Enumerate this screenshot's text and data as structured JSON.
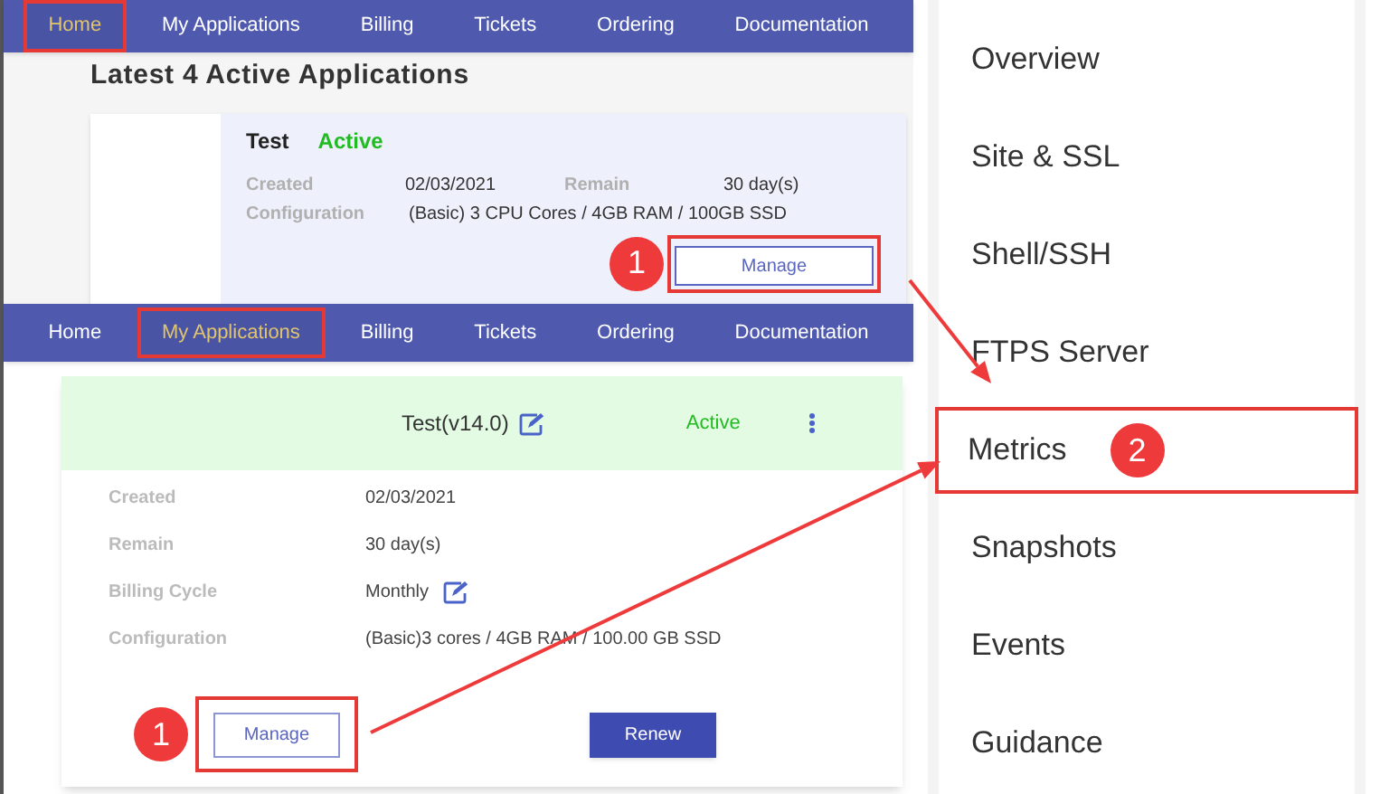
{
  "top_panel": {
    "nav": [
      {
        "label": "Home",
        "selected": true,
        "highlighted": true
      },
      {
        "label": "My Applications",
        "selected": false,
        "highlighted": false
      },
      {
        "label": "Billing",
        "selected": false,
        "highlighted": false
      },
      {
        "label": "Tickets",
        "selected": false,
        "highlighted": false
      },
      {
        "label": "Ordering",
        "selected": false,
        "highlighted": false
      },
      {
        "label": "Documentation",
        "selected": false,
        "highlighted": false
      }
    ],
    "heading": "Latest 4 Active Applications",
    "card": {
      "name": "Test",
      "status": "Active",
      "rows": [
        {
          "cells": [
            {
              "label": "Created",
              "value": "02/03/2021"
            },
            {
              "label": "Remain",
              "value": "30 day(s)"
            }
          ]
        },
        {
          "cells": [
            {
              "label": "Configuration",
              "value": "(Basic) 3 CPU Cores / 4GB RAM / 100GB SSD"
            }
          ]
        }
      ],
      "button": {
        "label": "Manage",
        "highlighted": true
      },
      "callout": "1"
    }
  },
  "bottom_panel": {
    "nav": [
      {
        "label": "Home",
        "selected": false,
        "highlighted": false
      },
      {
        "label": "My Applications",
        "selected": true,
        "highlighted": true
      },
      {
        "label": "Billing",
        "selected": false,
        "highlighted": false
      },
      {
        "label": "Tickets",
        "selected": false,
        "highlighted": false
      },
      {
        "label": "Ordering",
        "selected": false,
        "highlighted": false
      },
      {
        "label": "Documentation",
        "selected": false,
        "highlighted": false
      }
    ],
    "card": {
      "title": "Test(v14.0)",
      "status": "Active",
      "fields": [
        {
          "label": "Created",
          "value": "02/03/2021",
          "editable": false
        },
        {
          "label": "Remain",
          "value": "30 day(s)",
          "editable": false
        },
        {
          "label": "Billing Cycle",
          "value": "Monthly",
          "editable": true
        },
        {
          "label": "Configuration",
          "value": "(Basic)3 cores / 4GB RAM / 100.00 GB SSD",
          "editable": false
        }
      ],
      "callout": "1",
      "buttons": [
        {
          "label": "Manage",
          "kind": "outline",
          "highlighted": true
        },
        {
          "label": "Renew",
          "kind": "primary",
          "highlighted": false
        }
      ]
    }
  },
  "menu": {
    "items": [
      {
        "label": "Overview",
        "highlighted": false
      },
      {
        "label": "Site & SSL",
        "highlighted": false
      },
      {
        "label": "Shell/SSH",
        "highlighted": false
      },
      {
        "label": "FTPS Server",
        "highlighted": false
      },
      {
        "label": "Metrics",
        "highlighted": true,
        "callout": "2"
      },
      {
        "label": "Snapshots",
        "highlighted": false
      },
      {
        "label": "Events",
        "highlighted": false
      },
      {
        "label": "Guidance",
        "highlighted": false
      }
    ]
  }
}
